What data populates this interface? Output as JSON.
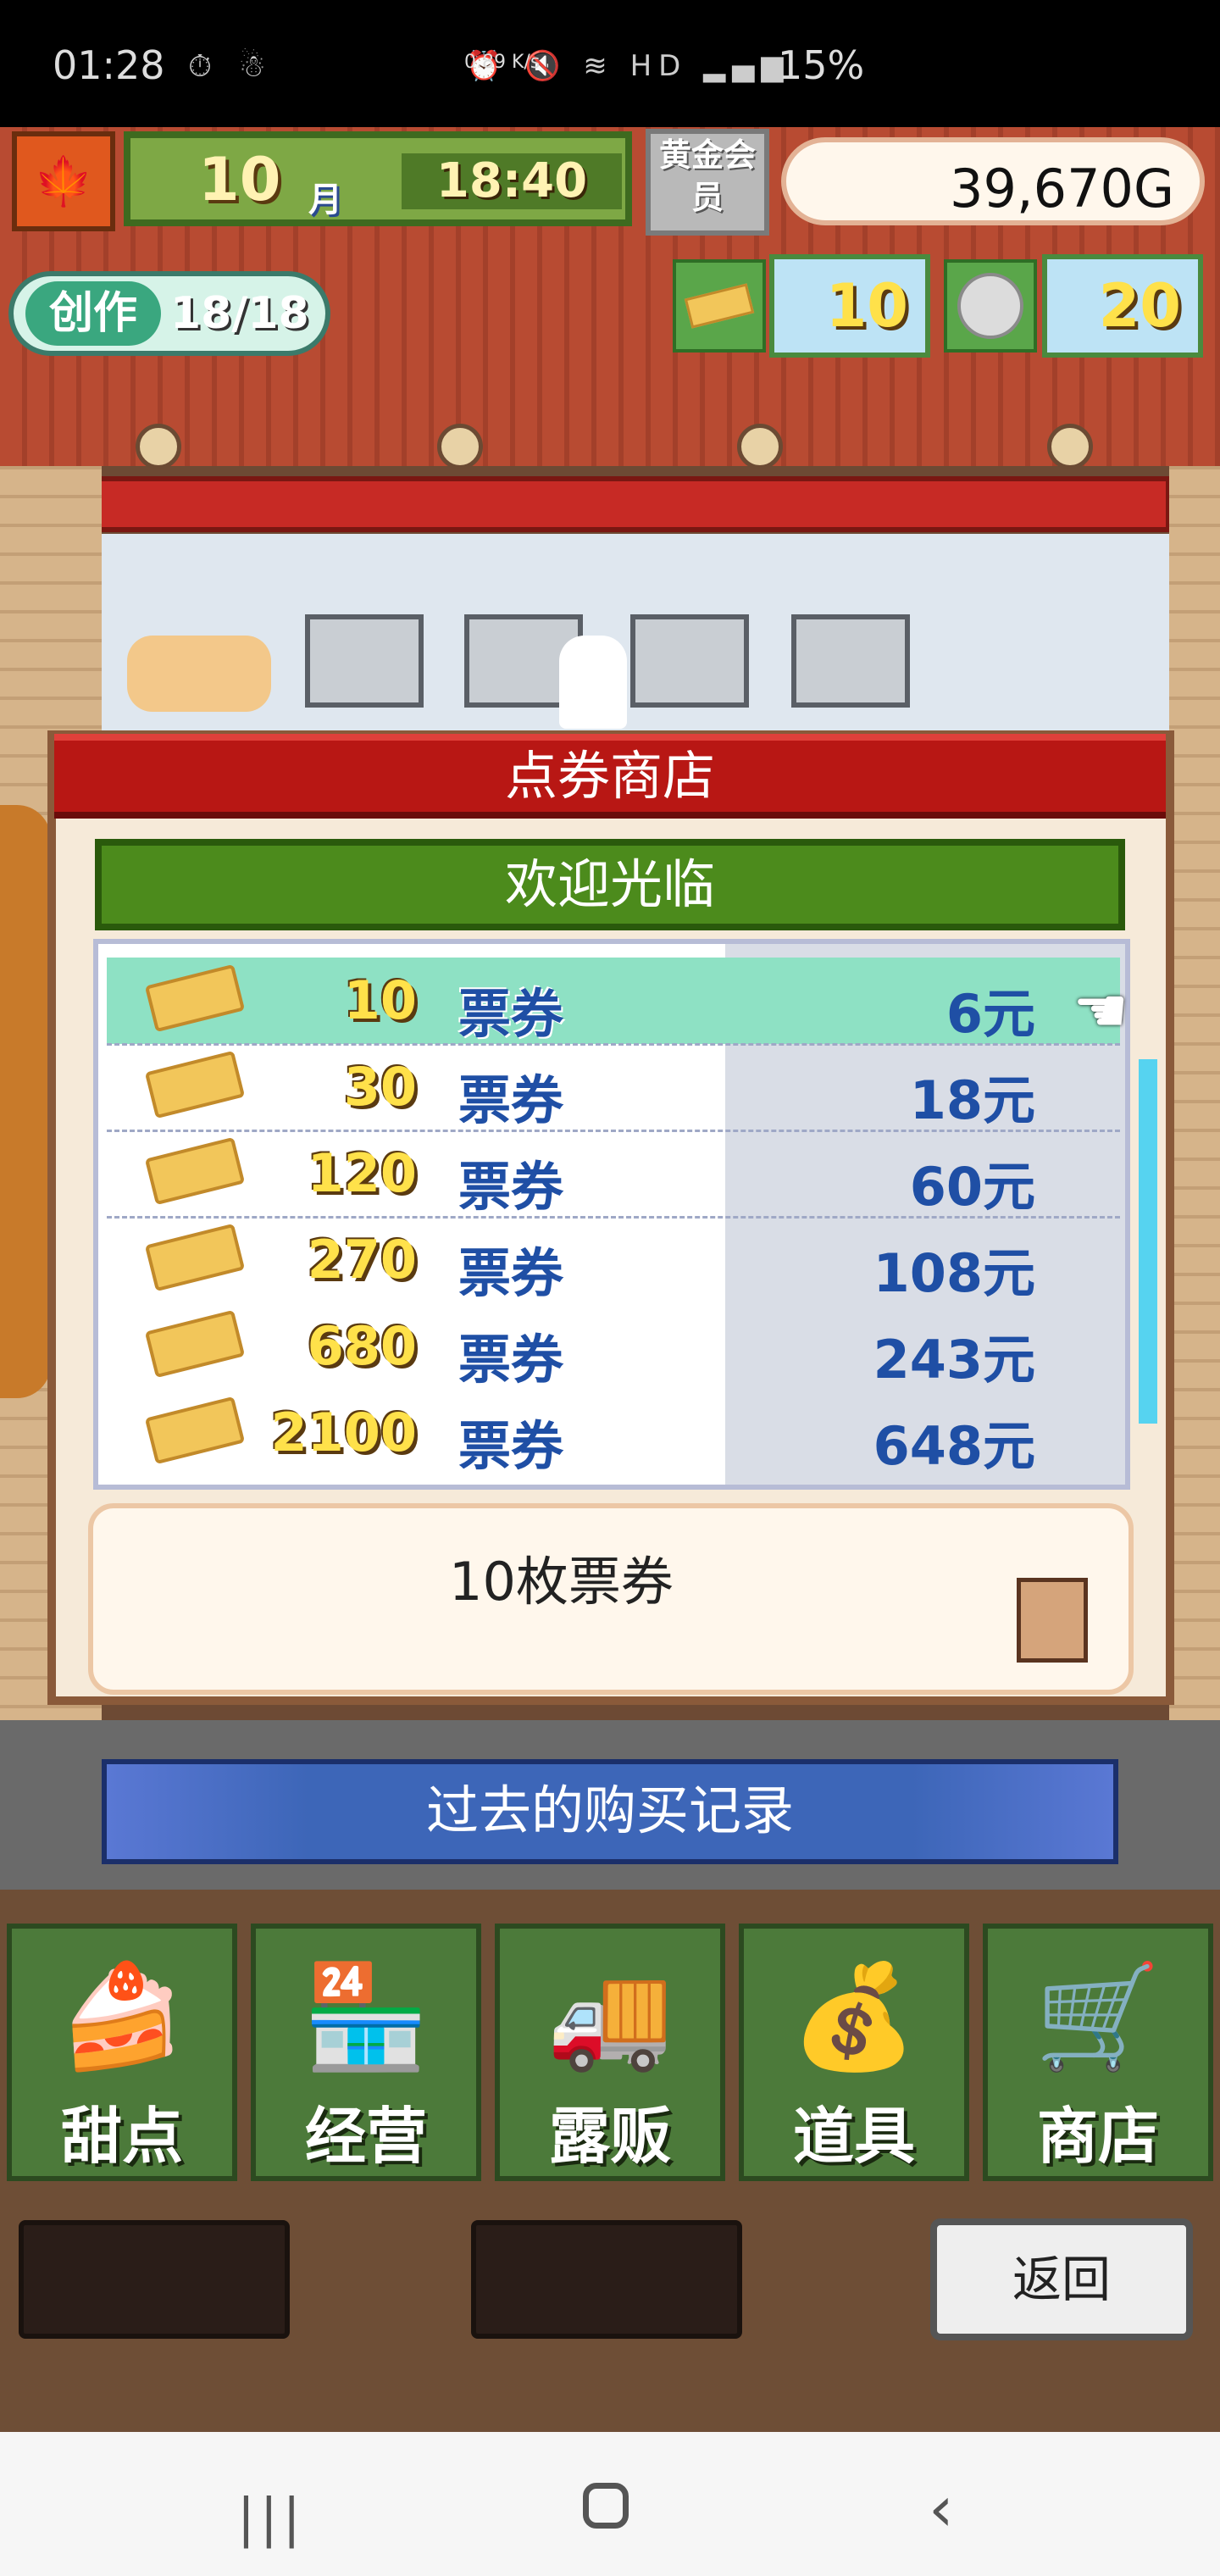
{
  "status_bar": {
    "time": "01:28",
    "net_speed": "0.89 K/s",
    "battery": "15%"
  },
  "hud": {
    "season_icon": "maple-leaf-icon",
    "month": "10",
    "month_unit": "月",
    "clock": "18:40",
    "gold_member": "黄金会员",
    "money": "39,670G",
    "create_label": "创作",
    "create_value": "18/18",
    "tickets": "10",
    "coins": "20"
  },
  "dialog": {
    "title": "点券商店",
    "welcome": "欢迎光临",
    "unit_label": "票券",
    "items": [
      {
        "qty": "10",
        "price": "6元",
        "selected": true
      },
      {
        "qty": "30",
        "price": "18元",
        "selected": false
      },
      {
        "qty": "120",
        "price": "60元",
        "selected": false
      },
      {
        "qty": "270",
        "price": "108元",
        "selected": false
      },
      {
        "qty": "680",
        "price": "243元",
        "selected": false
      },
      {
        "qty": "2100",
        "price": "648元",
        "selected": false
      }
    ],
    "description": "10枚票券",
    "history_button": "过去的购买记录"
  },
  "menu": {
    "items": [
      {
        "label": "甜点",
        "icon": "cake-icon"
      },
      {
        "label": "经营",
        "icon": "shop-icon"
      },
      {
        "label": "露贩",
        "icon": "food-truck-icon"
      },
      {
        "label": "道具",
        "icon": "item-bag-icon"
      },
      {
        "label": "商店",
        "icon": "shopping-cart-icon"
      }
    ],
    "back_button": "返回"
  },
  "colors": {
    "title_red": "#b81714",
    "welcome_green": "#4c8b1c",
    "price_blue": "#1f4fa5",
    "selected_row": "#8ee1c4"
  }
}
